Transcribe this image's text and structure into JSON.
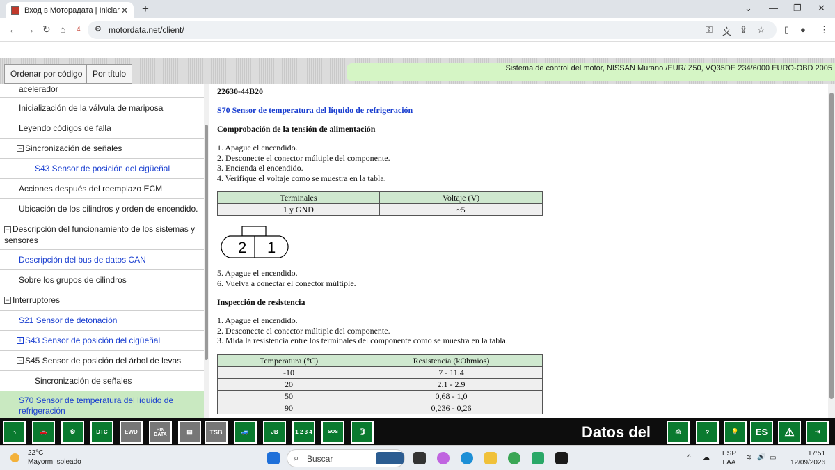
{
  "browser": {
    "tab_title": "Вход в Моторадата | Iniciar sesió",
    "new_tab": "+",
    "address_url": "motordata.net/client/",
    "badge": "4"
  },
  "header": {
    "btn_by_code": "Ordenar por código",
    "btn_by_title": "Por título",
    "vehicle": "Sistema de control del motor, NISSAN Murano /EUR/ Z50, VQ35DE 234/6000 EURO-OBD 2005"
  },
  "sidebar": {
    "items": [
      {
        "label": "acelerador"
      },
      {
        "label": "Inicialización de la válvula de mariposa"
      },
      {
        "label": "Leyendo códigos de falla"
      },
      {
        "label": "Sincronización de señales",
        "expander": "−"
      },
      {
        "label": "S43 Sensor de posición del cigüeñal"
      },
      {
        "label": "Acciones después del reemplazo ECM"
      },
      {
        "label": "Ubicación de los cilindros y orden de encendido."
      },
      {
        "label": "Descripción del funcionamiento de los sistemas y sensores",
        "expander": "−"
      },
      {
        "label": "Descripción del bus de datos CAN"
      },
      {
        "label": "Sobre los grupos de cilindros"
      },
      {
        "label": "Interruptores",
        "expander": "−"
      },
      {
        "label": "S21 Sensor de detonación"
      },
      {
        "label": "S43 Sensor de posición del cigüeñal",
        "expander": "+"
      },
      {
        "label": "S45 Sensor de posición del árbol de levas",
        "expander": "−"
      },
      {
        "label": "Sincronización de señales"
      },
      {
        "label": "S70 Sensor de temperatura del líquido de refrigeración"
      }
    ]
  },
  "content": {
    "part_code": "22630-44B20",
    "component_title": "S70 Sensor de temperatura del líquido de refrigeración",
    "section1_title": "Comprobación de la tensión de alimentación",
    "section1_steps": [
      "1. Apague el encendido.",
      "2. Desconecte el conector múltiple del componente.",
      "3. Encienda el encendido.",
      "4. Verifique el voltaje como se muestra en la tabla."
    ],
    "voltage_table": {
      "headers": [
        "Terminales",
        "Voltaje (V)"
      ],
      "rows": [
        [
          "1 y GND",
          "~5"
        ]
      ]
    },
    "connector_pins": [
      "2",
      "1"
    ],
    "section1_steps_b": [
      "5. Apague el encendido.",
      "6. Vuelva a conectar el conector múltiple."
    ],
    "section2_title": "Inspección de resistencia",
    "section2_steps": [
      "1. Apague el encendido.",
      "2. Desconecte el conector múltiple del componente.",
      "3. Mida la resistencia entre los terminales del componente como se muestra en la tabla."
    ],
    "resistance_table": {
      "headers": [
        "Temperatura (°C)",
        "Resistencia (kOhmios)"
      ],
      "rows": [
        [
          "-10",
          "7 - 11.4"
        ],
        [
          "20",
          "2.1 - 2.9"
        ],
        [
          "50",
          "0,68 - 1,0"
        ],
        [
          "90",
          "0,236 - 0,26"
        ]
      ]
    }
  },
  "toolbar": {
    "datos_label": "Datos del",
    "lang": "ES",
    "btn_dtc": "DTC",
    "btn_ewd": "EWD",
    "btn_pin": "PIN",
    "btn_data": "DATA",
    "btn_tsb": "TSB",
    "btn_jb": "JB",
    "btn_grid": "1 2 3 4",
    "btn_sos": "SOS"
  },
  "taskbar": {
    "temp": "22°C",
    "weather": "Mayorm. soleado",
    "search_placeholder": "Buscar",
    "lang1": "ESP",
    "lang2": "LAA",
    "time": "17:51",
    "date": "12/09/2026"
  },
  "colors": {
    "accent_green": "#0a7a2f",
    "link_blue": "#1a3fd0",
    "selection_green": "#c9e9c1",
    "table_header": "#cfe8cf"
  }
}
